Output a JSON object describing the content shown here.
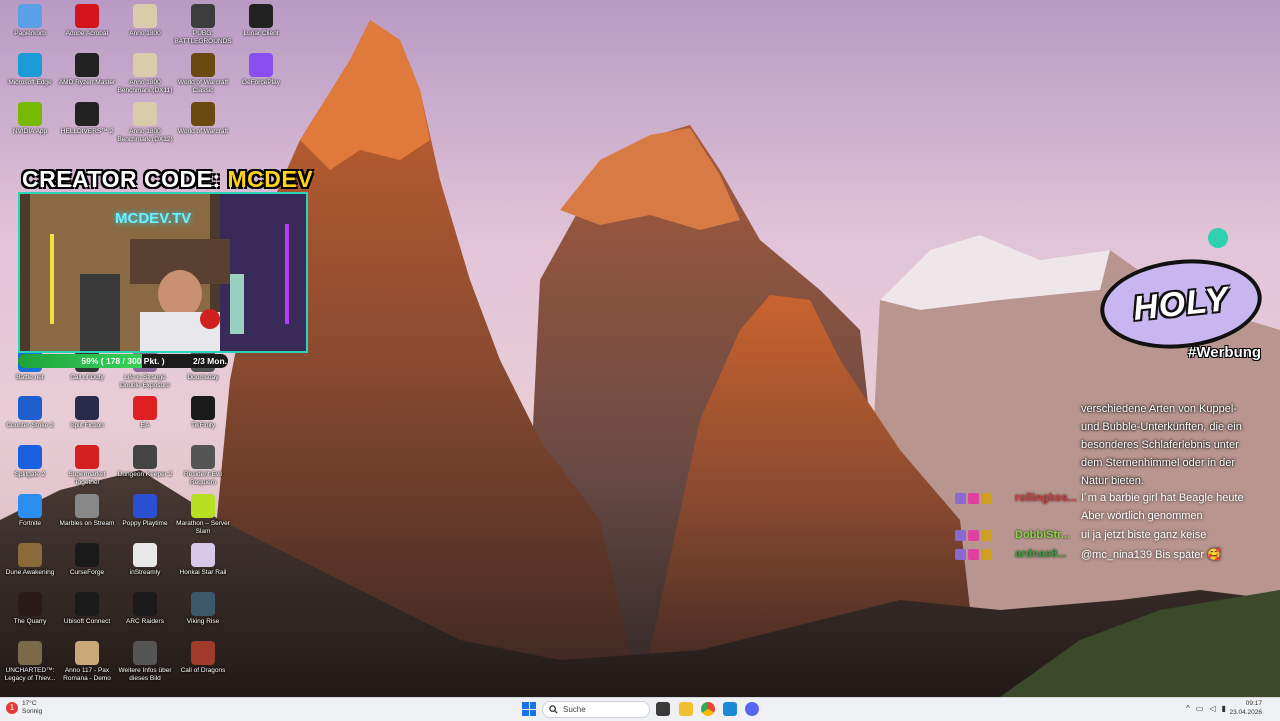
{
  "desktop_icons": [
    {
      "label": "Papierkorb",
      "icon": "recycle-bin-icon",
      "color": "#5aa0e8"
    },
    {
      "label": "Adobe Acrobat",
      "icon": "acrobat-icon",
      "color": "#d4141b"
    },
    {
      "label": "Anno 1800",
      "icon": "anno-icon",
      "color": "#d8ccaa"
    },
    {
      "label": "PUBG: BATTLEGROUNDS",
      "icon": "pubg-icon",
      "color": "#3c3c3c"
    },
    {
      "label": "Lunar Client",
      "icon": "lunar-icon",
      "color": "#222222"
    },
    {
      "label": "Microsoft Edge",
      "icon": "edge-icon",
      "color": "#1a9bd7"
    },
    {
      "label": "AMD Ryzen Master",
      "icon": "ryzen-icon",
      "color": "#222222"
    },
    {
      "label": "Anno 1800 Benchmark (DX11)",
      "icon": "anno-icon",
      "color": "#d8ccaa"
    },
    {
      "label": "World of Warcraft Classic",
      "icon": "wow-icon",
      "color": "#6b4a12"
    },
    {
      "label": "GeForcePlay",
      "icon": "gamepad-icon",
      "color": "#8a4df0"
    },
    {
      "label": "NVIDIA App",
      "icon": "nvidia-icon",
      "color": "#76b900"
    },
    {
      "label": "HELLDIVERS™ 2",
      "icon": "helldivers-icon",
      "color": "#222222"
    },
    {
      "label": "Anno 1800 Benchmark (DX12)",
      "icon": "anno-icon",
      "color": "#d8ccaa"
    },
    {
      "label": "World of Warcraft",
      "icon": "wow-icon",
      "color": "#6b4a12"
    },
    {
      "label": "Battle.net",
      "icon": "battlenet-icon",
      "color": "#1a6fd8"
    },
    {
      "label": "Call of Duty",
      "icon": "cod-icon",
      "color": "#333333"
    },
    {
      "label": "Life is Strange Double Exposure",
      "icon": "lis-icon",
      "color": "#8a6a9a"
    },
    {
      "label": "Doomsday",
      "icon": "doomsday-icon",
      "color": "#555555"
    },
    {
      "label": "Counter-Strike 2",
      "icon": "cs2-icon",
      "color": "#1e5fd0"
    },
    {
      "label": "Split Fiction",
      "icon": "splitfiction-icon",
      "color": "#2a2a4a"
    },
    {
      "label": "EA",
      "icon": "ea-icon",
      "color": "#e02020"
    },
    {
      "label": "TikFinity",
      "icon": "tikfinity-icon",
      "color": "#1a1a1a"
    },
    {
      "label": "Splitgate 2",
      "icon": "splitgate-icon",
      "color": "#1a5fe0"
    },
    {
      "label": "Supermarket Together",
      "icon": "supermarket-icon",
      "color": "#d42020"
    },
    {
      "label": "Dungeon Keeper 2",
      "icon": "dungeon-keeper-icon",
      "color": "#444444"
    },
    {
      "label": "Resident Evil Requiem",
      "icon": "re-icon",
      "color": "#555555"
    },
    {
      "label": "Fortnite",
      "icon": "fortnite-icon",
      "color": "#2a8ef0"
    },
    {
      "label": "Marbles on Stream",
      "icon": "marbles-icon",
      "color": "#888888"
    },
    {
      "label": "Poppy Playtime",
      "icon": "poppy-icon",
      "color": "#2a4fd0"
    },
    {
      "label": "Marathon – Server Slam",
      "icon": "marathon-icon",
      "color": "#b6e020"
    },
    {
      "label": "Dune Awakening",
      "icon": "dune-icon",
      "color": "#8a6a3a"
    },
    {
      "label": "CurseForge",
      "icon": "curseforge-icon",
      "color": "#1a1a1a"
    },
    {
      "label": "inStreamly",
      "icon": "instreamly-icon",
      "color": "#e8e8e8"
    },
    {
      "label": "Honkai Star Rail",
      "icon": "honkai-icon",
      "color": "#d8c8e8"
    },
    {
      "label": "The Quarry",
      "icon": "quarry-icon",
      "color": "#2a1a1a"
    },
    {
      "label": "Ubisoft Connect",
      "icon": "ubisoft-icon",
      "color": "#1a1a1a"
    },
    {
      "label": "ARC Raiders",
      "icon": "arc-raiders-icon",
      "color": "#1a1a1a"
    },
    {
      "label": "Viking Rise",
      "icon": "viking-icon",
      "color": "#3a5a6a"
    },
    {
      "label": "UNCHARTED™: Legacy of Thiev...",
      "icon": "uncharted-icon",
      "color": "#7a6a4a"
    },
    {
      "label": "Anno 117 - Pax Romana - Demo",
      "icon": "anno117-icon",
      "color": "#caa878"
    },
    {
      "label": "Weitere Infos über dieses Bild",
      "icon": "camera-icon",
      "color": "#555555"
    },
    {
      "label": "Call of Dragons",
      "icon": "dragons-icon",
      "color": "#a03a2a"
    }
  ],
  "overlay": {
    "creator_prefix": "CREATOR CODE: ",
    "creator_code": "MCDEV",
    "webcam_title": "MCDEV.TV",
    "progress_text": "59% ( 178 / 300 Pkt. )",
    "progress_fraction": 0.59,
    "progress_extra": "2/3 Mon.",
    "ad_brand": "HOLY",
    "ad_tag": "#Werbung"
  },
  "chat": {
    "body_lines": [
      "verschiedene Arten von Kuppel-",
      "und Bubble-Unterkünften, die ein",
      "besonderes Schlaferlebnis unter",
      "dem Sternenhimmel oder in der",
      "Natur bieten."
    ],
    "messages": [
      {
        "user": "rollingkos...",
        "user_color": "#d04040",
        "text": "I´m a barbie girl hat Beagle heute"
      },
      {
        "user": "",
        "user_color": "#ffffff",
        "text": "Aber wörtlich genommen"
      },
      {
        "user": "DobbiStr...",
        "user_color": "#8ad04a",
        "text": "ui ja jetzt biste ganz keise"
      },
      {
        "user": "ardnas8...",
        "user_color": "#3aa040",
        "text": "@mc_nina139 Bis später 🥰"
      }
    ]
  },
  "taskbar": {
    "weather_temp": "17°C",
    "weather_desc": "Sonnig",
    "search_placeholder": "Suche",
    "time": "09:17",
    "date": "23.04.2026"
  }
}
